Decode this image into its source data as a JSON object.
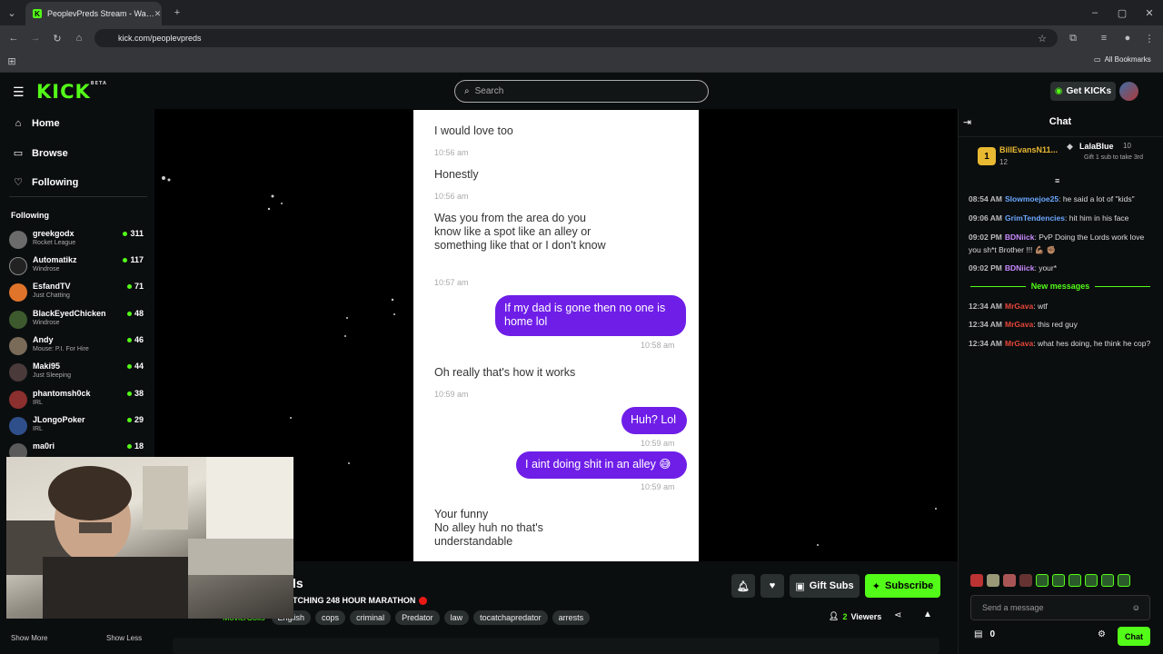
{
  "browser": {
    "tab_title": "PeoplevPreds Stream - Wa…",
    "url": "kick.com/peoplevpreds",
    "all_bookmarks": "All Bookmarks"
  },
  "header": {
    "logo": "KICK",
    "logo_badge": "BETA",
    "search_placeholder": "Search",
    "get_kicks": "Get KICKs"
  },
  "sidebar": {
    "nav": [
      {
        "label": "Home",
        "icon": "home-icon"
      },
      {
        "label": "Browse",
        "icon": "compass-icon"
      },
      {
        "label": "Following",
        "icon": "heart-icon"
      }
    ],
    "following_heading": "Following",
    "channels": [
      {
        "name": "greekgodx",
        "game": "Rocket League",
        "viewers": "311"
      },
      {
        "name": "Automatikz",
        "game": "Windrose",
        "viewers": "117"
      },
      {
        "name": "EsfandTV",
        "game": "Just Chatting",
        "viewers": "71"
      },
      {
        "name": "BlackEyedChicken",
        "game": "Windrose",
        "viewers": "48"
      },
      {
        "name": "Andy",
        "game": "Mouse: P.I. For Hire",
        "viewers": "46"
      },
      {
        "name": "Maki95",
        "game": "Just Sleeping",
        "viewers": "44"
      },
      {
        "name": "phantomsh0ck",
        "game": "IRL",
        "viewers": "38"
      },
      {
        "name": "JLongoPoker",
        "game": "IRL",
        "viewers": "29"
      },
      {
        "name": "ma0ri",
        "game": "",
        "viewers": "18"
      }
    ],
    "show_more": "Show More",
    "show_less": "Show Less"
  },
  "video": {
    "messages": [
      {
        "kind": "in",
        "text": "I would love too",
        "time": "10:56 am"
      },
      {
        "kind": "in",
        "text": "Honestly",
        "time": "10:56 am"
      },
      {
        "kind": "in",
        "text": "Was you from the area do you know like a spot like an alley or something like that or I don't know",
        "time": "10:57 am"
      },
      {
        "kind": "out",
        "text": "If my dad is gone then no one is home lol",
        "time": "10:58 am"
      },
      {
        "kind": "in",
        "text": "Oh really that's how it works",
        "time": "10:59 am"
      },
      {
        "kind": "out",
        "text": "Huh? Lol",
        "time": "10:59 am"
      },
      {
        "kind": "out",
        "text": "I aint doing shit in an alley 😅",
        "time": "10:59 am"
      },
      {
        "kind": "in",
        "text": "Your funny\n No alley huh no that's understandable",
        "time": ""
      }
    ]
  },
  "stream": {
    "title_fragment": "ls",
    "subtitle": "TCHING 248 HOUR MARATHON",
    "category": "Movie/Colls",
    "tags": [
      "English",
      "cops",
      "criminal",
      "Predator",
      "law",
      "tocatchapredator",
      "arrests"
    ],
    "gift_subs": "Gift Subs",
    "subscribe": "Subscribe",
    "viewers_count": "2",
    "viewers_label": "Viewers"
  },
  "chat": {
    "title": "Chat",
    "pinned": [
      {
        "rank": "1",
        "name": "BillEvansN11...",
        "amount": "12"
      },
      {
        "name": "LalaBlue",
        "amount": "10",
        "note": "Gift 1 sub to take 3rd"
      }
    ],
    "messages_before": [
      {
        "time": "08:54 AM",
        "user": "Slowmoejoe25",
        "color": "#6aa8ff",
        "text": "he said a lot of \"kids\""
      },
      {
        "time": "09:06 AM",
        "user": "GrimTendencies",
        "color": "#6aa8ff",
        "text": "hit him in his face"
      },
      {
        "time": "09:02 PM",
        "user": "BDNiick",
        "color": "#c98bff",
        "text": "PvP Doing the Lords work love you sh*t Brother !!! 💪🏽 ✊🏽"
      },
      {
        "time": "09:02 PM",
        "user": "BDNiick",
        "color": "#c98bff",
        "text": "your*"
      }
    ],
    "new_messages_label": "New messages",
    "messages_after": [
      {
        "time": "12:34 AM",
        "user": "MrGava",
        "color": "#e8463a",
        "text": "wtf"
      },
      {
        "time": "12:34 AM",
        "user": "MrGava",
        "color": "#e8463a",
        "text": "this red guy"
      },
      {
        "time": "12:34 AM",
        "user": "MrGava",
        "color": "#e8463a",
        "text": "what hes doing, he think he cop?"
      }
    ],
    "input_placeholder": "Send a message",
    "points": "0",
    "chat_button": "Chat"
  }
}
